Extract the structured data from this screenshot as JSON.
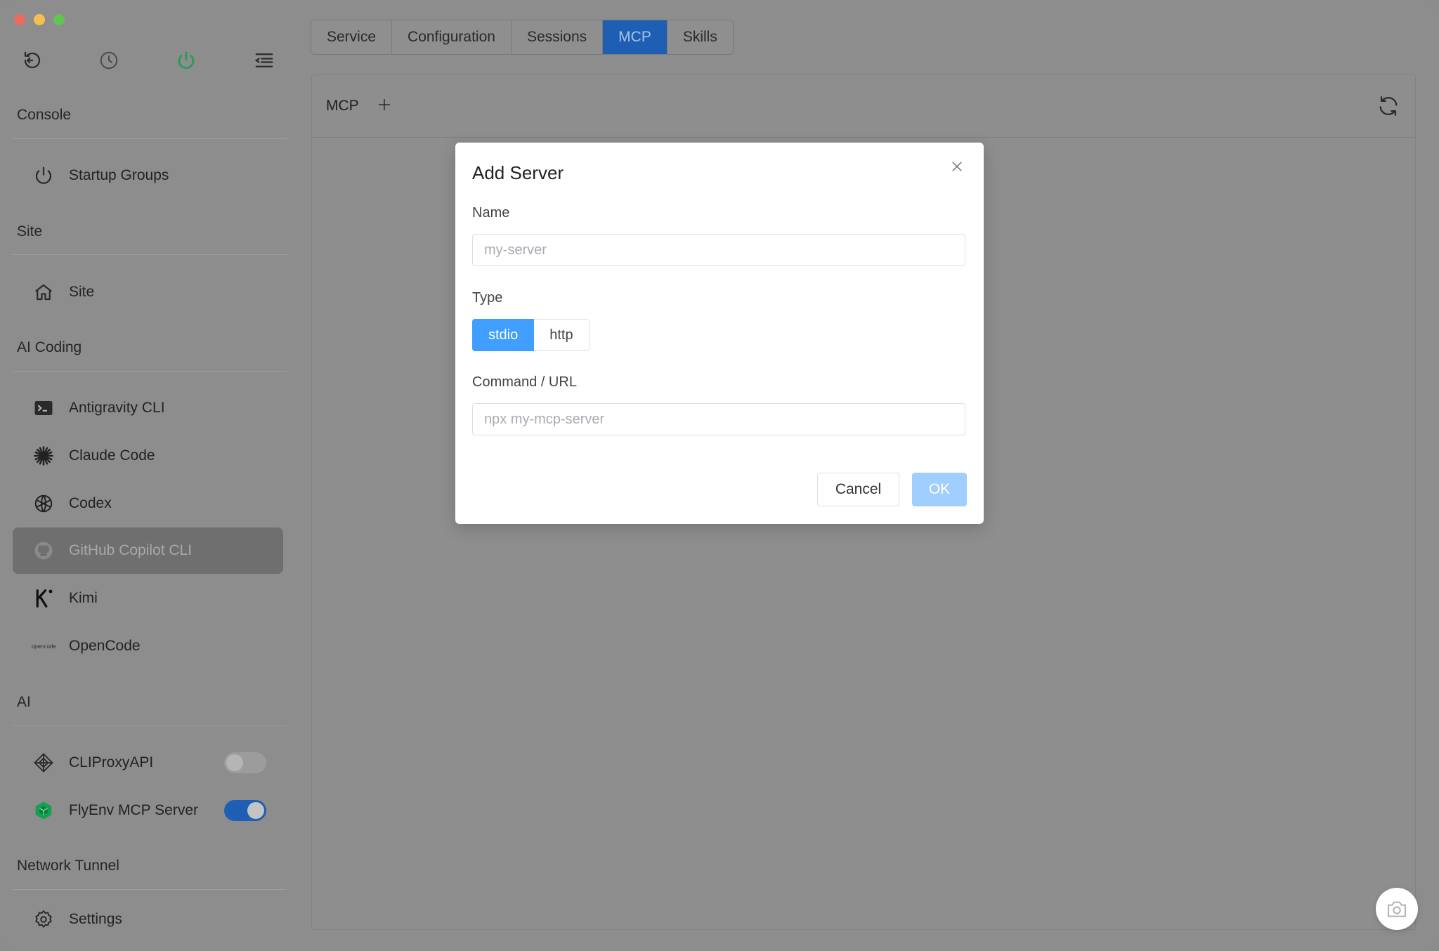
{
  "sidebar": {
    "sections": {
      "console": "Console",
      "site": "Site",
      "ai_coding": "AI Coding",
      "ai": "AI",
      "network_tunnel": "Network Tunnel"
    },
    "items": {
      "startup_groups": "Startup Groups",
      "site": "Site",
      "antigravity": "Antigravity CLI",
      "claude": "Claude Code",
      "codex": "Codex",
      "copilot": "GitHub Copilot CLI",
      "kimi": "Kimi",
      "opencode": "OpenCode",
      "cliproxy": "CLIProxyAPI",
      "flyenv_mcp": "FlyEnv MCP Server",
      "settings": "Settings"
    },
    "toggles": {
      "cliproxy_on": false,
      "flyenv_mcp_on": true
    },
    "opencode_logo_text": "opencode"
  },
  "tabs": [
    "Service",
    "Configuration",
    "Sessions",
    "MCP",
    "Skills"
  ],
  "active_tab": "MCP",
  "panel": {
    "title": "MCP"
  },
  "modal": {
    "title": "Add Server",
    "name_label": "Name",
    "name_placeholder": "my-server",
    "type_label": "Type",
    "type_options": [
      "stdio",
      "http"
    ],
    "type_selected": "stdio",
    "command_label": "Command / URL",
    "command_placeholder": "npx my-mcp-server",
    "cancel_label": "Cancel",
    "ok_label": "OK"
  },
  "colors": {
    "accent": "#409eff",
    "tab_active": "#1e5fb3",
    "power_green": "#1f9d55",
    "flyenv_green": "#12a150"
  }
}
